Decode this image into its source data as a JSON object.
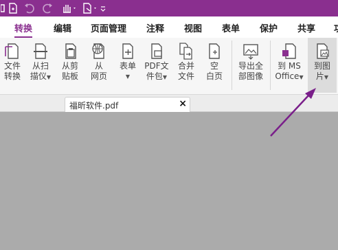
{
  "colors": {
    "brand": "#8a2f8f",
    "arrow": "#7a1f8a",
    "canvas": "#ababab"
  },
  "tabs": [
    {
      "label": "转换",
      "active": true
    },
    {
      "label": "编辑"
    },
    {
      "label": "页面管理"
    },
    {
      "label": "注释"
    },
    {
      "label": "视图"
    },
    {
      "label": "表单"
    },
    {
      "label": "保护"
    },
    {
      "label": "共享"
    },
    {
      "label": "功"
    }
  ],
  "ribbon": {
    "file_convert": {
      "line1": "文件",
      "line2": "转换",
      "icon": "file-convert-icon"
    },
    "from_scanner": {
      "line1": "从扫",
      "line2": "描仪",
      "icon": "scanner-icon"
    },
    "from_clipboard": {
      "line1": "从剪",
      "line2": "贴板",
      "icon": "clipboard-icon"
    },
    "from_web": {
      "line1": "从",
      "line2": "网页",
      "icon": "globe-icon"
    },
    "form": {
      "line1": "表单",
      "icon": "form-icon"
    },
    "pdf_package": {
      "line1": "PDF文",
      "line2": "件包",
      "icon": "package-icon"
    },
    "merge": {
      "line1": "合并",
      "line2": "文件",
      "icon": "merge-icon"
    },
    "blank": {
      "line1": "空",
      "line2": "白页",
      "icon": "blank-page-icon"
    },
    "export_images": {
      "line1": "导出全",
      "line2": "部图像",
      "icon": "export-images-icon"
    },
    "to_office": {
      "line1": "到 MS",
      "line2": "Office",
      "icon": "office-icon"
    },
    "to_image": {
      "line1": "到图",
      "line2": "片",
      "icon": "image-icon"
    }
  },
  "document": {
    "tab_name": "福昕软件.pdf",
    "close": "×"
  }
}
